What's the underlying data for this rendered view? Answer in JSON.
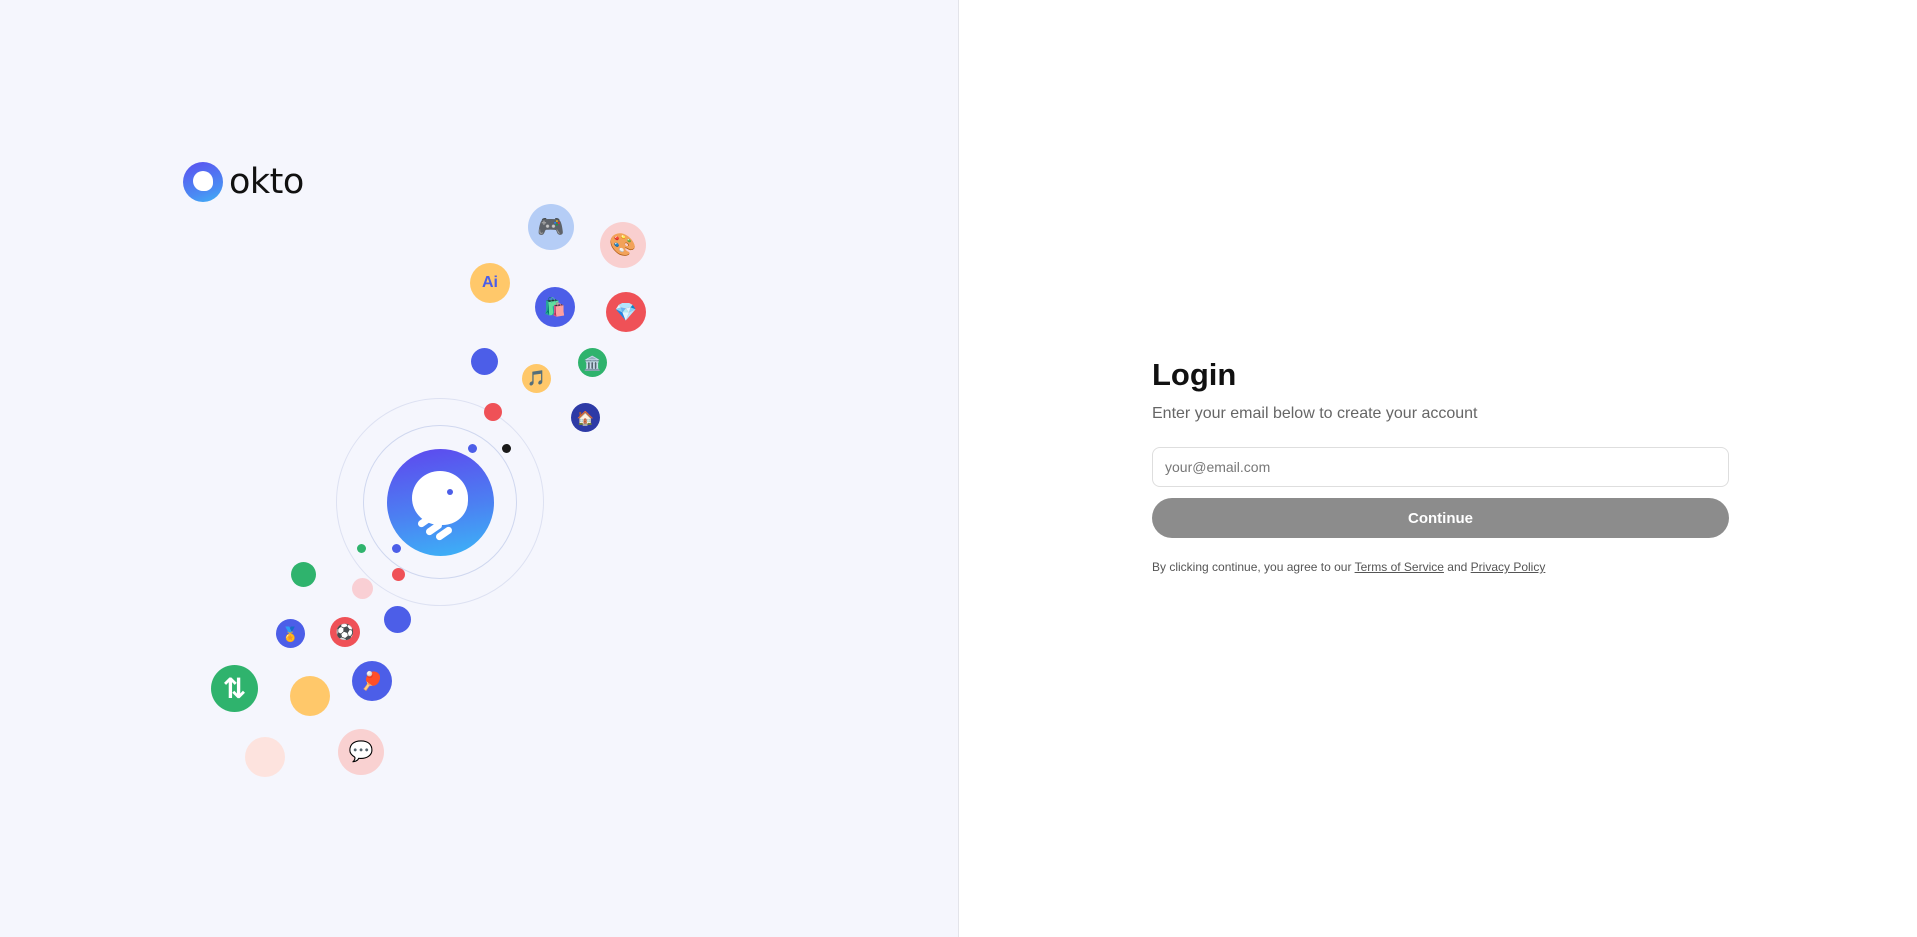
{
  "brand": {
    "name": "okto"
  },
  "illustration": {
    "icons": {
      "gamepad": "🎮",
      "palette": "🎨",
      "ai": "Ai",
      "shopping": "🛍️",
      "gem": "💎",
      "music": "🎵",
      "museum": "🏛️",
      "house": "🏠",
      "medal": "🏅",
      "soccer": "⚽",
      "ping_pong": "🏓",
      "exchange": "⇅",
      "chat": "💬"
    }
  },
  "login": {
    "title": "Login",
    "subtitle": "Enter your email below to create your account",
    "email_placeholder": "your@email.com",
    "email_value": "",
    "continue_label": "Continue",
    "terms_prefix": "By clicking continue, you agree to our",
    "terms_link": "Terms of Service",
    "terms_and": "and",
    "privacy_link": "Privacy Policy"
  },
  "colors": {
    "left_bg": "#f5f6fd",
    "button_bg": "#8c8c8c",
    "brand_blue": "#4c5ee8",
    "green": "#2fb36d",
    "red": "#ef5157",
    "yellow": "#ffc86a"
  }
}
